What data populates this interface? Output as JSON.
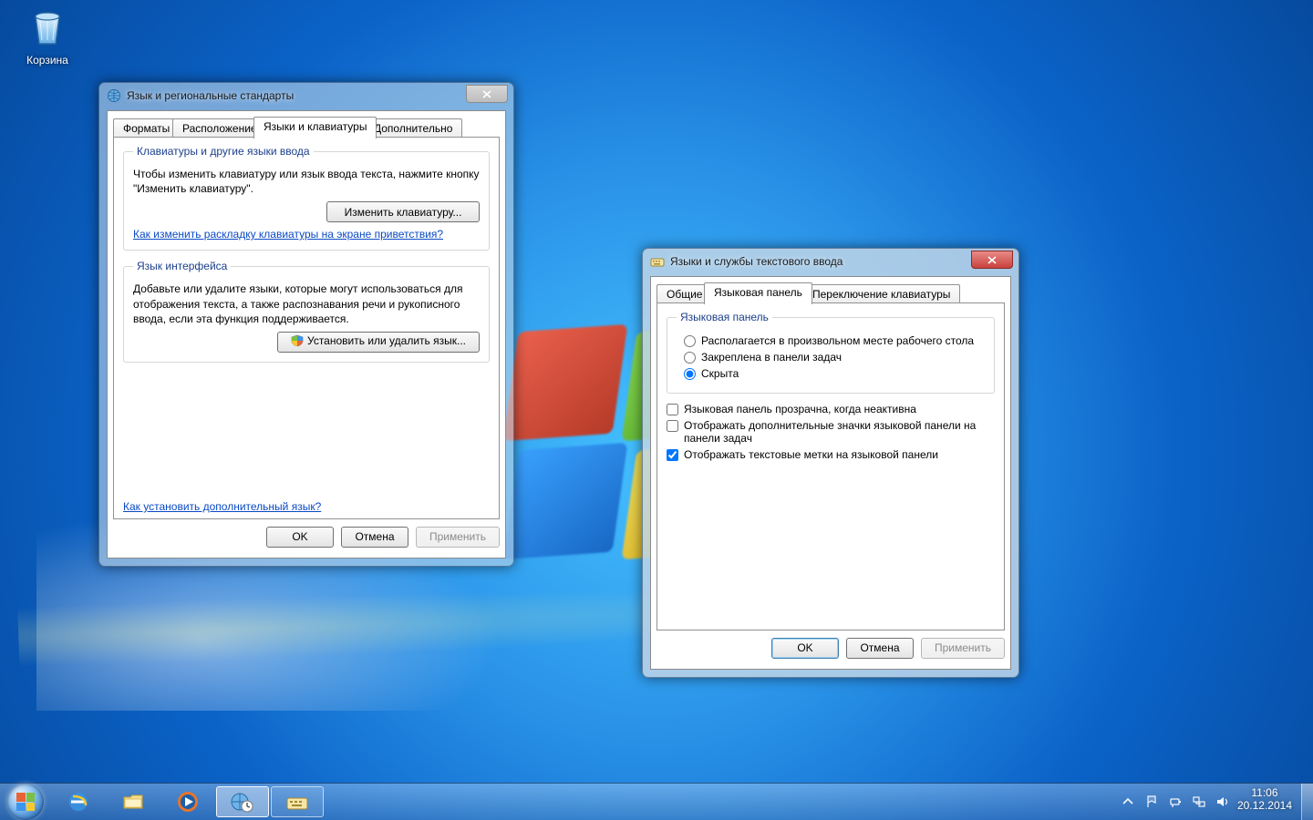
{
  "desktop": {
    "recycle_bin_label": "Корзина"
  },
  "dlg_region": {
    "title": "Язык и региональные стандарты",
    "tabs": {
      "formats": "Форматы",
      "location": "Расположение",
      "keyboards": "Языки и клавиатуры",
      "additional": "Дополнительно"
    },
    "group_keyboards": {
      "legend": "Клавиатуры и другие языки ввода",
      "desc": "Чтобы изменить клавиатуру или язык ввода текста, нажмите кнопку \"Изменить клавиатуру\".",
      "change_keyboard_btn": "Изменить клавиатуру...",
      "help_link": "Как изменить раскладку клавиатуры на экране приветствия?"
    },
    "group_uilang": {
      "legend": "Язык интерфейса",
      "desc": "Добавьте или удалите языки, которые могут использоваться для отображения текста, а также распознавания речи и рукописного ввода, если эта функция поддерживается.",
      "install_lang_btn": "Установить или удалить язык..."
    },
    "help_link2": "Как установить дополнительный язык?",
    "btn_ok": "OK",
    "btn_cancel": "Отмена",
    "btn_apply": "Применить"
  },
  "dlg_textinput": {
    "title": "Языки и службы текстового ввода",
    "tabs": {
      "general": "Общие",
      "langbar": "Языковая панель",
      "switch": "Переключение клавиатуры"
    },
    "group_langbar": {
      "legend": "Языковая панель",
      "opt_floating": "Располагается в произвольном месте рабочего стола",
      "opt_docked": "Закреплена в панели задач",
      "opt_hidden": "Скрыта"
    },
    "chk_transparent": "Языковая панель прозрачна, когда неактивна",
    "chk_extra_icons": "Отображать дополнительные значки языковой панели на панели задач",
    "chk_text_labels": "Отображать текстовые метки на языковой панели",
    "btn_ok": "OK",
    "btn_cancel": "Отмена",
    "btn_apply": "Применить"
  },
  "taskbar": {
    "time": "11:06",
    "date": "20.12.2014"
  }
}
